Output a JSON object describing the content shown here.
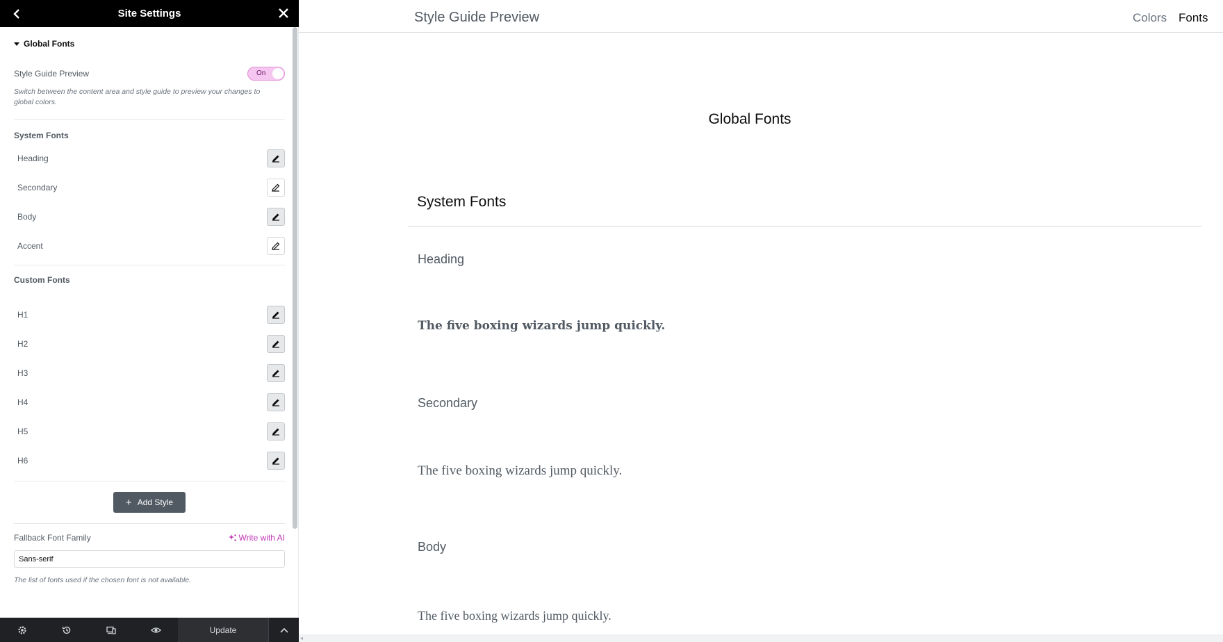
{
  "panel": {
    "title": "Site Settings",
    "section_title": "Global Fonts",
    "style_guide_preview": {
      "label": "Style Guide Preview",
      "toggle_text": "On",
      "enabled": true,
      "help": "Switch between the content area and style guide to preview your changes to global colors."
    },
    "system_fonts": {
      "title": "System Fonts",
      "items": [
        {
          "label": "Heading"
        },
        {
          "label": "Secondary"
        },
        {
          "label": "Body"
        },
        {
          "label": "Accent"
        }
      ]
    },
    "custom_fonts": {
      "title": "Custom Fonts",
      "items": [
        {
          "label": "H1"
        },
        {
          "label": "H2"
        },
        {
          "label": "H3"
        },
        {
          "label": "H4"
        },
        {
          "label": "H5"
        },
        {
          "label": "H6"
        }
      ]
    },
    "add_style_label": "Add Style",
    "fallback": {
      "label": "Fallback Font Family",
      "ai_label": "Write with AI",
      "value": "Sans-serif",
      "help": "The list of fonts used if the chosen font is not available."
    },
    "footer": {
      "update_label": "Update"
    }
  },
  "preview": {
    "title": "Style Guide Preview",
    "tabs": [
      {
        "label": "Colors",
        "active": false
      },
      {
        "label": "Fonts",
        "active": true
      }
    ],
    "global_title": "Global Fonts",
    "system_title": "System Fonts",
    "fonts": [
      {
        "name": "Heading",
        "sample": "The five boxing wizards jump quickly."
      },
      {
        "name": "Secondary",
        "sample": "The five boxing wizards jump quickly."
      },
      {
        "name": "Body",
        "sample": "The five boxing wizards jump quickly."
      }
    ]
  },
  "colors": {
    "accent": "#c036b5",
    "toggle_bg": "#f5c6f0",
    "header_bg": "#000000",
    "footer_bg": "#1f2124"
  }
}
